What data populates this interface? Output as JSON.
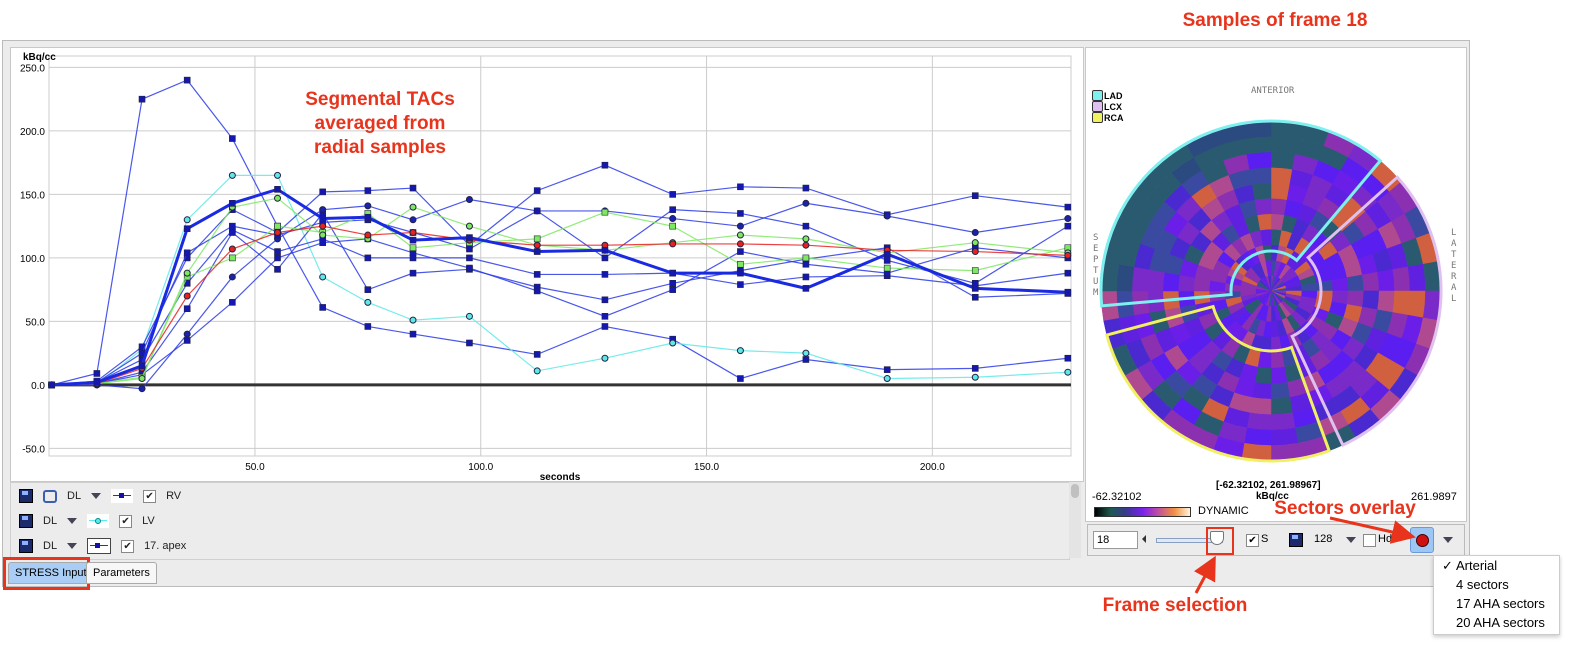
{
  "annotations": {
    "samples_title": "Samples of frame 18",
    "tacs_note": "Segmental TACs averaged from radial samples",
    "sectors_overlay": "Sectors overlay",
    "frame_selection": "Frame selection"
  },
  "legend": {
    "rows": [
      {
        "mode": "DL",
        "label": "RV",
        "checked": true
      },
      {
        "mode": "DL",
        "label": "LV",
        "checked": true
      },
      {
        "mode": "DL",
        "label": "17. apex",
        "checked": true
      }
    ]
  },
  "tabs": [
    {
      "label": "STRESS Input",
      "active": true
    },
    {
      "label": "Parameters",
      "active": false
    }
  ],
  "polar": {
    "legend": [
      {
        "label": "LAD",
        "color": "#7ff0f0"
      },
      {
        "label": "LCX",
        "color": "#e0c0f0"
      },
      {
        "label": "RCA",
        "color": "#f0f060"
      }
    ],
    "orient": {
      "top": "ANTERIOR",
      "left": "SEPTUM",
      "right": "LATERAL"
    },
    "range_label": "[-62.32102, 261.98967]",
    "unit": "kBq/cc",
    "min": "-62.32102",
    "max": "261.9897",
    "colormap": "DYNAMIC"
  },
  "toolbar": {
    "frame": "18",
    "s_label": "S",
    "s_checked": true,
    "resolution": "128",
    "hdr_label": "Hdr",
    "hdr_checked": false
  },
  "menu": {
    "items": [
      {
        "label": "Arterial",
        "checked": true
      },
      {
        "label": "4 sectors"
      },
      {
        "label": "17 AHA sectors"
      },
      {
        "label": "20 AHA sectors"
      }
    ]
  },
  "chart_data": {
    "type": "line",
    "xlabel": "seconds",
    "ylabel": "kBq/cc",
    "xlim": [
      4.4,
      230.7
    ],
    "ylim": [
      -56,
      259
    ],
    "xticks": [
      50,
      100,
      150,
      200
    ],
    "yticks": [
      -50,
      0,
      50,
      100,
      150,
      200,
      250
    ],
    "grid": true,
    "x": [
      5,
      15,
      25,
      35,
      45,
      55,
      65,
      75,
      85,
      97.5,
      112.5,
      127.5,
      142.5,
      157.5,
      172,
      190,
      209.5,
      230
    ],
    "series": [
      {
        "name": "RV",
        "color": "#2a3ae8",
        "marker": "square",
        "values": [
          0,
          9,
          225,
          240,
          194,
          125,
          61,
          46,
          40,
          33,
          24,
          46,
          36,
          5,
          20,
          12,
          13,
          21
        ]
      },
      {
        "name": "LV",
        "color": "#5fe8e8",
        "marker": "circle",
        "values": [
          0,
          0,
          28,
          130,
          165,
          165,
          85,
          65,
          51,
          54,
          11,
          21,
          33,
          27,
          25,
          5,
          6,
          10
        ]
      },
      {
        "color": "#2a3ae8",
        "marker": "square",
        "values": [
          0,
          3,
          30,
          100,
          138,
          120,
          152,
          153,
          155,
          110,
          153,
          173,
          150,
          156,
          155,
          134,
          149,
          140
        ]
      },
      {
        "color": "#2a3ae8",
        "marker": "square",
        "values": [
          0,
          2,
          20,
          80,
          122,
          105,
          115,
          100,
          100,
          100,
          87,
          87,
          88,
          79,
          85,
          86,
          78,
          88
        ]
      },
      {
        "color": "#2a3ae8",
        "marker": "square",
        "values": [
          0,
          1,
          10,
          60,
          120,
          91,
          135,
          75,
          88,
          91,
          77,
          67,
          80,
          90,
          99,
          108,
          69,
          72
        ]
      },
      {
        "color": "#2a3ae8",
        "marker": "circle",
        "values": [
          0,
          0,
          -3,
          40,
          85,
          115,
          138,
          141,
          130,
          146,
          137,
          137,
          131,
          125,
          143,
          133,
          120,
          131
        ]
      },
      {
        "color": "#2a3ae8",
        "marker": "square",
        "values": [
          0,
          1,
          8,
          35,
          65,
          100,
          112,
          115,
          104,
          92,
          74,
          54,
          75,
          105,
          95,
          88,
          108,
          100
        ]
      },
      {
        "color": "#2a3ae8",
        "marker": "square",
        "values": [
          0,
          2,
          25,
          104,
          125,
          118,
          128,
          130,
          120,
          107,
          137,
          100,
          138,
          135,
          125,
          98,
          80,
          125
        ]
      },
      {
        "color": "#7ee860",
        "marker": "square",
        "values": [
          0,
          1,
          6,
          85,
          100,
          125,
          120,
          135,
          108,
          112,
          115,
          136,
          125,
          95,
          100,
          92,
          90,
          108
        ]
      },
      {
        "color": "#7ee860",
        "marker": "circle",
        "values": [
          0,
          1,
          5,
          88,
          140,
          147,
          118,
          115,
          140,
          125,
          110,
          106,
          112,
          118,
          115,
          104,
          112,
          104
        ]
      },
      {
        "color": "#e82020",
        "marker": "circle",
        "values": [
          0,
          1,
          13,
          70,
          107,
          120,
          125,
          118,
          120,
          114,
          110,
          110,
          111,
          111,
          110,
          106,
          105,
          102
        ]
      },
      {
        "name": "17. apex",
        "color": "#1a2ae0",
        "marker": "square",
        "thick": true,
        "values": [
          0,
          2,
          15,
          123,
          143,
          154,
          131,
          132,
          114,
          116,
          105,
          106,
          88,
          88,
          76,
          103,
          76,
          73
        ]
      }
    ]
  }
}
